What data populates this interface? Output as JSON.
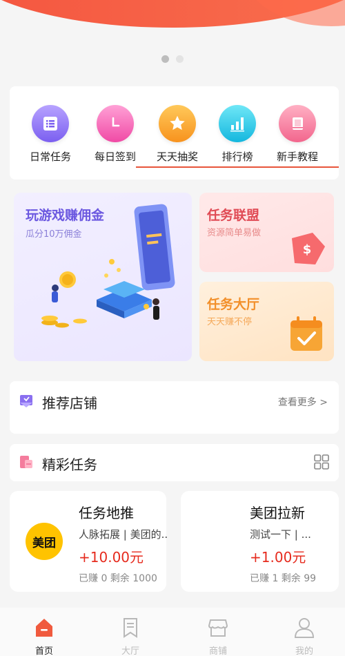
{
  "banner": {
    "pages": 2,
    "active_index": 0
  },
  "quick_nav": [
    {
      "label": "日常任务",
      "icon": "list-icon",
      "color": "#8a6ff0"
    },
    {
      "label": "每日签到",
      "icon": "clock-icon",
      "color": "#f45fb2"
    },
    {
      "label": "天天抽奖",
      "icon": "star-icon",
      "color": "#f9a42b"
    },
    {
      "label": "排行榜",
      "icon": "bar-chart-icon",
      "color": "#20c7e6"
    },
    {
      "label": "新手教程",
      "icon": "book-icon",
      "color": "#f47c9d"
    }
  ],
  "promo": {
    "main": {
      "title": "玩游戏赚佣金",
      "subtitle": "瓜分10万佣金"
    },
    "league": {
      "title": "任务联盟",
      "subtitle": "资源简单易做"
    },
    "hall": {
      "title": "任务大厅",
      "subtitle": "天天赚不停"
    }
  },
  "recommended": {
    "title": "推荐店铺",
    "more": "查看更多 >"
  },
  "featured": {
    "title": "精彩任务"
  },
  "tasks": [
    {
      "logo": "美团",
      "name": "任务地推",
      "desc": "人脉拓展 | 美团的..",
      "price": "+10.00元",
      "stat": "已赚 0 剩余 1000"
    },
    {
      "name": "美团拉新",
      "desc": "测试一下 | ...",
      "price": "+1.00元",
      "stat": "已赚 1 剩余 99"
    }
  ],
  "tabbar": [
    {
      "label": "首页",
      "icon": "home-icon",
      "active": true
    },
    {
      "label": "大厅",
      "icon": "bookmark-icon",
      "active": false
    },
    {
      "label": "商铺",
      "icon": "shop-icon",
      "active": false
    },
    {
      "label": "我的",
      "icon": "user-icon",
      "active": false
    }
  ],
  "colors": {
    "accent": "#e8543a",
    "price": "#e62b1e"
  }
}
